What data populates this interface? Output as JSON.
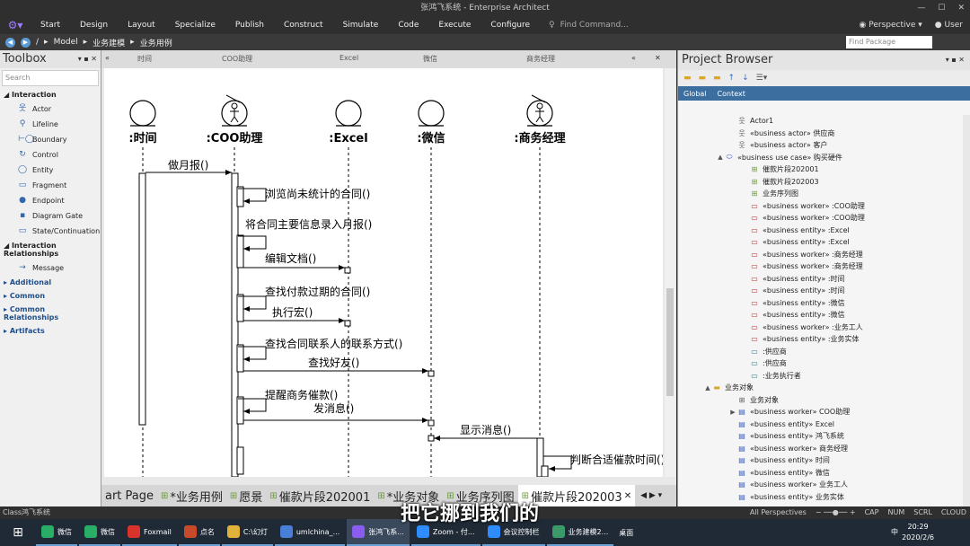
{
  "window_title": "张鸿飞系统 - Enterprise Architect",
  "menu": {
    "items": [
      "Start",
      "Design",
      "Layout",
      "Specialize",
      "Publish",
      "Construct",
      "Simulate",
      "Code",
      "Execute",
      "Configure"
    ],
    "find_command": "Find Command...",
    "perspective": "Perspective",
    "user": "User"
  },
  "breadcrumb": {
    "path": [
      "/",
      "Model",
      "业务建模",
      "业务用例"
    ],
    "find_package_placeholder": "Find Package"
  },
  "toolbox": {
    "title": "Toolbox",
    "search_placeholder": "Search",
    "interaction_label": "Interaction",
    "interaction_items": [
      {
        "label": "Actor",
        "icon": "actor-icon"
      },
      {
        "label": "Lifeline",
        "icon": "lifeline-icon"
      },
      {
        "label": "Boundary",
        "icon": "boundary-icon"
      },
      {
        "label": "Control",
        "icon": "control-icon"
      },
      {
        "label": "Entity",
        "icon": "entity-icon"
      },
      {
        "label": "Fragment",
        "icon": "fragment-icon"
      },
      {
        "label": "Endpoint",
        "icon": "endpoint-icon"
      },
      {
        "label": "Diagram Gate",
        "icon": "diagram-gate-icon"
      },
      {
        "label": "State/Continuation",
        "icon": "state-icon"
      }
    ],
    "relationships_label": "Interaction Relationships",
    "relationship_items": [
      {
        "label": "Message",
        "icon": "message-arrow-icon"
      }
    ],
    "other_sections": [
      "Additional",
      "Common",
      "Common Relationships",
      "Artifacts"
    ]
  },
  "diagram": {
    "header_labels": [
      "时间",
      "COO助理",
      "Excel",
      "微信",
      "商务经理"
    ],
    "lifelines": [
      {
        "name": ":时间",
        "kind": "entity"
      },
      {
        "name": ":COO助理",
        "kind": "worker"
      },
      {
        "name": ":Excel",
        "kind": "entity"
      },
      {
        "name": ":微信",
        "kind": "entity"
      },
      {
        "name": ":商务经理",
        "kind": "worker"
      }
    ],
    "messages": [
      {
        "label": "做月报()",
        "from": 0,
        "to": 1
      },
      {
        "label": "浏览尚未统计的合同()",
        "from": 1,
        "to": 1
      },
      {
        "label": "将合同主要信息录入月报()",
        "from": 1,
        "to": 1
      },
      {
        "label": "编辑文档()",
        "from": 1,
        "to": 2
      },
      {
        "label": "查找付款过期的合同()",
        "from": 1,
        "to": 1
      },
      {
        "label": "执行宏()",
        "from": 1,
        "to": 2
      },
      {
        "label": "查找合同联系人的联系方式()",
        "from": 1,
        "to": 1
      },
      {
        "label": "查找好友()",
        "from": 1,
        "to": 3
      },
      {
        "label": "提醒商务催款()",
        "from": 1,
        "to": 1
      },
      {
        "label": "发消息()",
        "from": 1,
        "to": 3
      },
      {
        "label": "显示消息()",
        "from": 4,
        "to": 3
      },
      {
        "label": "判断合适催款时间()",
        "from": 4,
        "to": 4
      }
    ]
  },
  "tabs": [
    {
      "label": "art Page",
      "active": false
    },
    {
      "label": "*业务用例",
      "active": false
    },
    {
      "label": "愿景",
      "active": false
    },
    {
      "label": "催款片段202001",
      "active": false
    },
    {
      "label": "*业务对象",
      "active": false
    },
    {
      "label": "业务序列图",
      "active": false
    },
    {
      "label": "催款片段202003",
      "active": true
    }
  ],
  "project_browser": {
    "title": "Project Browser",
    "subtabs": [
      "Global",
      "Context"
    ],
    "tree": [
      {
        "label": "Actor1",
        "indent": 5,
        "icon": "actor-icon",
        "toggle": ""
      },
      {
        "label": "«business actor» 供应商",
        "indent": 5,
        "icon": "actor-icon",
        "toggle": ""
      },
      {
        "label": "«business actor» 客户",
        "indent": 5,
        "icon": "actor-icon",
        "toggle": ""
      },
      {
        "label": "«business use case» 购买硬件",
        "indent": 4,
        "icon": "use-case-icon",
        "toggle": "▲"
      },
      {
        "label": "催款片段202001",
        "indent": 6,
        "icon": "sequence-diagram-icon",
        "toggle": ""
      },
      {
        "label": "催款片段202003",
        "indent": 6,
        "icon": "sequence-diagram-icon",
        "toggle": ""
      },
      {
        "label": "业务序列图",
        "indent": 6,
        "icon": "sequence-diagram-icon",
        "toggle": ""
      },
      {
        "label": "«business worker» :COO助理",
        "indent": 6,
        "icon": "instance-icon",
        "toggle": ""
      },
      {
        "label": "«business worker» :COO助理",
        "indent": 6,
        "icon": "instance-icon",
        "toggle": ""
      },
      {
        "label": "«business entity» :Excel",
        "indent": 6,
        "icon": "instance-icon",
        "toggle": ""
      },
      {
        "label": "«business entity» :Excel",
        "indent": 6,
        "icon": "instance-icon",
        "toggle": ""
      },
      {
        "label": "«business worker» :商务经理",
        "indent": 6,
        "icon": "instance-icon",
        "toggle": ""
      },
      {
        "label": "«business worker» :商务经理",
        "indent": 6,
        "icon": "instance-icon",
        "toggle": ""
      },
      {
        "label": "«business entity» :时间",
        "indent": 6,
        "icon": "instance-icon",
        "toggle": ""
      },
      {
        "label": "«business entity» :时间",
        "indent": 6,
        "icon": "instance-icon",
        "toggle": ""
      },
      {
        "label": "«business entity» :微信",
        "indent": 6,
        "icon": "instance-icon",
        "toggle": ""
      },
      {
        "label": "«business entity» :微信",
        "indent": 6,
        "icon": "instance-icon",
        "toggle": ""
      },
      {
        "label": "«business worker» :业务工人",
        "indent": 6,
        "icon": "instance-icon",
        "toggle": ""
      },
      {
        "label": "«business entity» :业务实体",
        "indent": 6,
        "icon": "instance-icon",
        "toggle": ""
      },
      {
        "label": ":供应商",
        "indent": 6,
        "icon": "actor-instance-icon",
        "toggle": ""
      },
      {
        "label": ":供应商",
        "indent": 6,
        "icon": "actor-instance-icon",
        "toggle": ""
      },
      {
        "label": ":业务执行者",
        "indent": 6,
        "icon": "actor-instance-icon",
        "toggle": ""
      },
      {
        "label": "业务对象",
        "indent": 3,
        "icon": "folder-icon",
        "toggle": "▲"
      },
      {
        "label": "业务对象",
        "indent": 5,
        "icon": "class-diagram-icon",
        "toggle": ""
      },
      {
        "label": "«business worker» COO助理",
        "indent": 5,
        "icon": "class-icon",
        "toggle": "▶"
      },
      {
        "label": "«business entity» Excel",
        "indent": 5,
        "icon": "class-icon",
        "toggle": ""
      },
      {
        "label": "«business entity» 鸿飞系统",
        "indent": 5,
        "icon": "class-icon",
        "toggle": ""
      },
      {
        "label": "«business worker» 商务经理",
        "indent": 5,
        "icon": "class-icon",
        "toggle": ""
      },
      {
        "label": "«business entity» 时间",
        "indent": 5,
        "icon": "class-icon",
        "toggle": ""
      },
      {
        "label": "«business entity» 微信",
        "indent": 5,
        "icon": "class-icon",
        "toggle": ""
      },
      {
        "label": "«business worker» 业务工人",
        "indent": 5,
        "icon": "class-icon",
        "toggle": ""
      },
      {
        "label": "«business entity» 业务实体",
        "indent": 5,
        "icon": "class-icon",
        "toggle": ""
      }
    ]
  },
  "status": {
    "left": "Class鸿飞系统",
    "perspectives": "All Perspectives",
    "indicators": [
      "CAP",
      "NUM",
      "SCRL",
      "CLOUD"
    ]
  },
  "taskbar": {
    "items": [
      {
        "label": "微信",
        "color": "#2aae67"
      },
      {
        "label": "微信",
        "color": "#2aae67"
      },
      {
        "label": "Foxmail",
        "color": "#d9342b"
      },
      {
        "label": "点名",
        "color": "#c94a2a"
      },
      {
        "label": "C:\\幻灯",
        "color": "#e0b23a"
      },
      {
        "label": "umlchina_...",
        "color": "#4a7fd8"
      },
      {
        "label": "张鸿飞系...",
        "color": "#8a5cf0"
      },
      {
        "label": "Zoom - 付...",
        "color": "#2d8cff"
      },
      {
        "label": "会议控制栏",
        "color": "#2d8cff"
      },
      {
        "label": "业务建模2...",
        "color": "#3a9a6a"
      }
    ],
    "desktop": "桌面",
    "time": "20:29",
    "date": "2020/2/6",
    "ime": "中"
  },
  "subtitle": "把它挪到我们的"
}
